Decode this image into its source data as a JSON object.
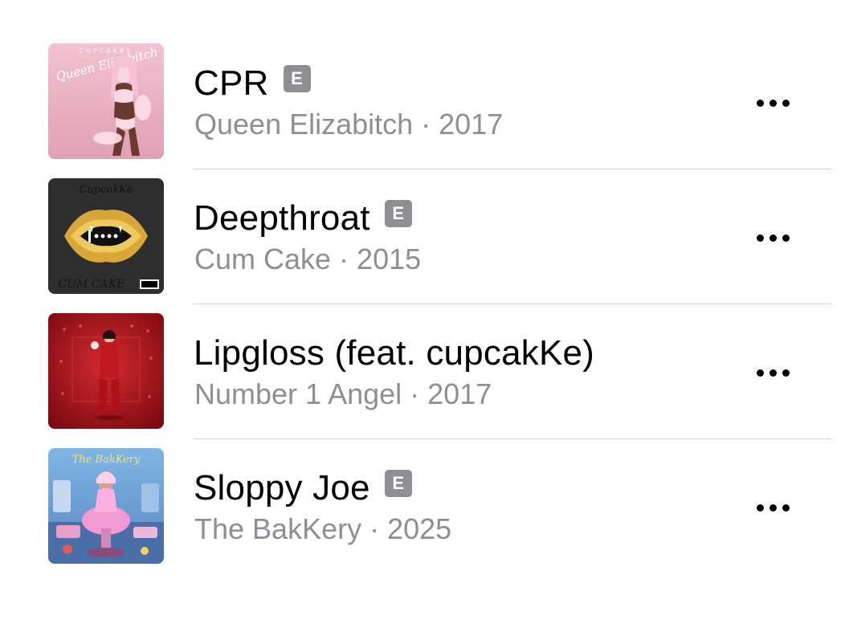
{
  "songs": [
    {
      "title": "CPR",
      "explicit": "E",
      "subtitle": "Queen Elizabitch · 2017",
      "art": {
        "name": "queen-elizabitch-cover",
        "colors": [
          "#e8a8b8",
          "#f4c6d2"
        ],
        "cover_text_top": "CUPCAKKE",
        "cover_text_script": "Queen Elizabitch"
      }
    },
    {
      "title": "Deepthroat",
      "explicit": "E",
      "subtitle": "Cum Cake · 2015",
      "art": {
        "name": "cum-cake-cover",
        "colors": [
          "#2b2b2b",
          "#d4a838"
        ],
        "cover_text_top": "CupcakKe",
        "cover_text_bottom": "CUM CAKE"
      }
    },
    {
      "title": "Lipgloss (feat. cupcakKe)",
      "explicit": "",
      "subtitle": "Number 1 Angel · 2017",
      "art": {
        "name": "number-1-angel-cover",
        "colors": [
          "#8a0f14",
          "#c4242a"
        ]
      }
    },
    {
      "title": "Sloppy Joe",
      "explicit": "E",
      "subtitle": "The BakKery · 2025",
      "art": {
        "name": "the-bakkery-cover",
        "colors": [
          "#6aa6d8",
          "#e89ad0"
        ],
        "cover_text_top": "The BakKery"
      }
    }
  ],
  "icons": {
    "more": "ellipsis-icon",
    "explicit": "explicit-badge"
  }
}
